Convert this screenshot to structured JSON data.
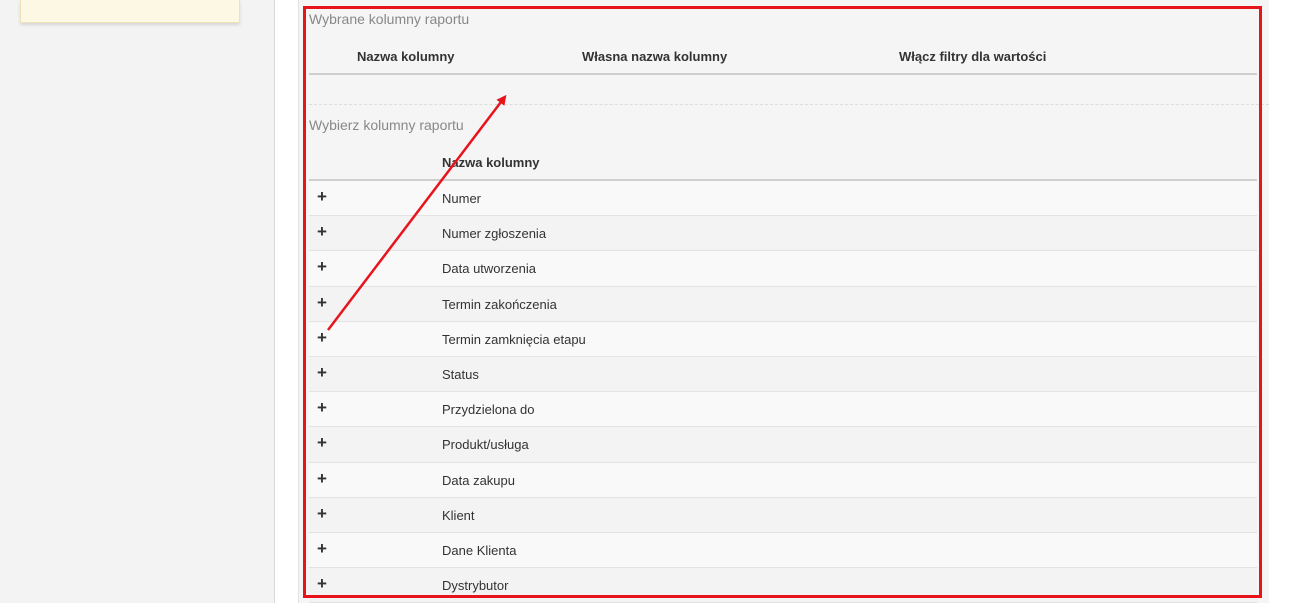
{
  "selected_section": {
    "title": "Wybrane kolumny raportu",
    "headers": {
      "column_name": "Nazwa kolumny",
      "custom_name": "Własna nazwa kolumny",
      "enable_filters": "Włącz filtry dla wartości"
    }
  },
  "choose_section": {
    "title": "Wybierz kolumny raportu",
    "header_column_name": "Nazwa kolumny",
    "add_symbol": "+",
    "rows": [
      {
        "label": "Numer"
      },
      {
        "label": "Numer zgłoszenia"
      },
      {
        "label": "Data utworzenia"
      },
      {
        "label": "Termin zakończenia"
      },
      {
        "label": "Termin zamknięcia etapu"
      },
      {
        "label": "Status"
      },
      {
        "label": "Przydzielona do"
      },
      {
        "label": "Produkt/usługa"
      },
      {
        "label": "Data zakupu"
      },
      {
        "label": "Klient"
      },
      {
        "label": "Dane Klienta"
      },
      {
        "label": "Dystrybutor"
      }
    ]
  },
  "annotation": {
    "color": "#e8141c"
  }
}
